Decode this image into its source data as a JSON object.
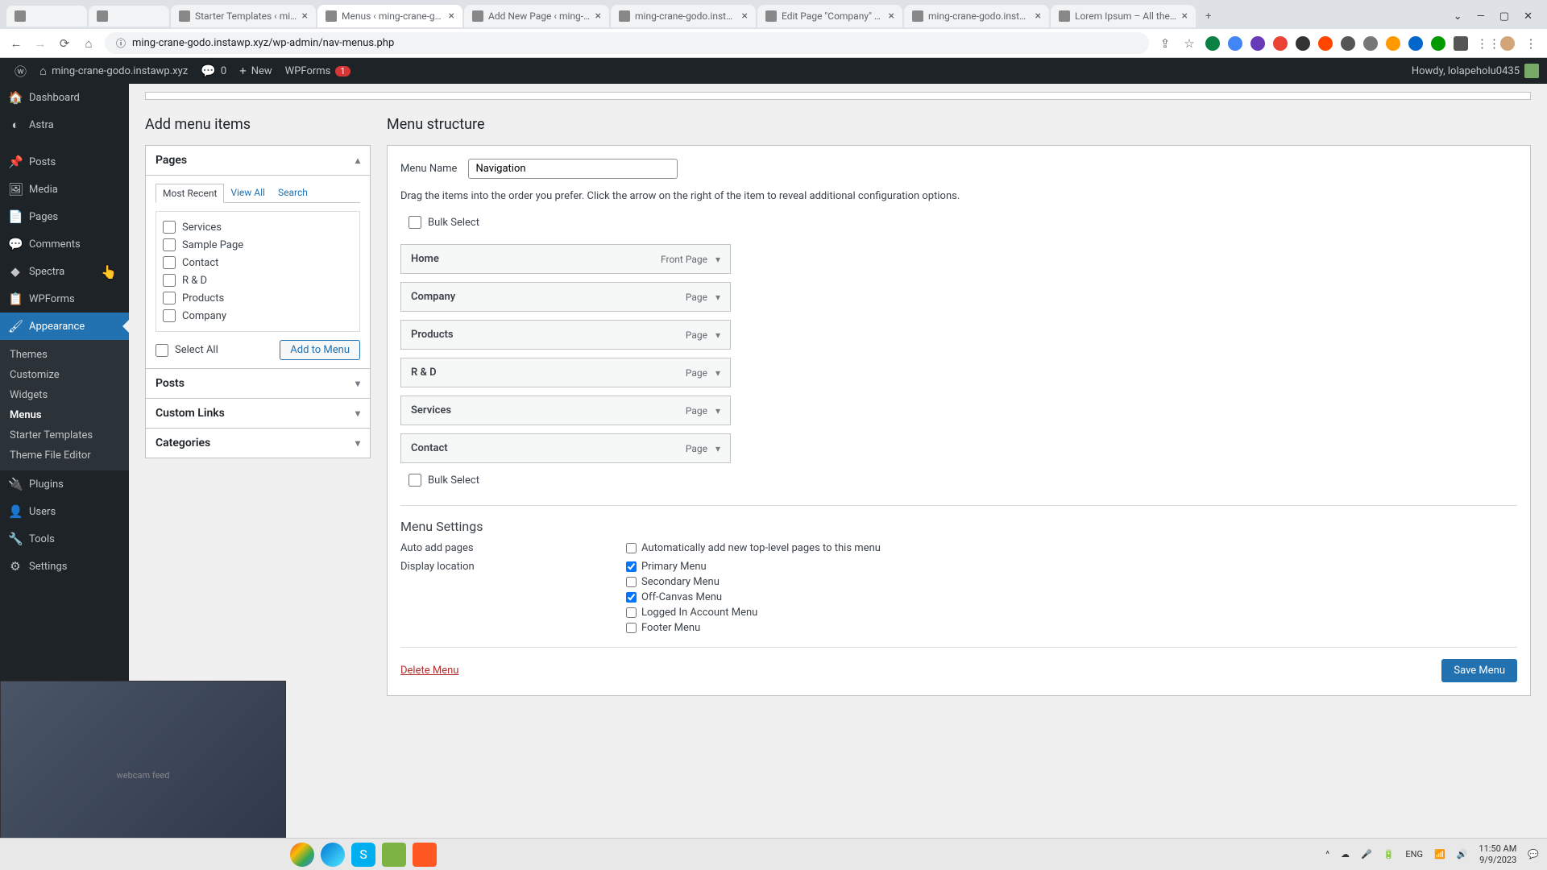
{
  "browser": {
    "tabs": [
      {
        "title": "Starter Templates ‹ ming-cran"
      },
      {
        "title": "Menus ‹ ming-crane-godo.",
        "active": true
      },
      {
        "title": "Add New Page ‹ ming-cran"
      },
      {
        "title": "ming-crane-godo.instawp.xyz"
      },
      {
        "title": "Edit Page \"Company\" ‹ ming"
      },
      {
        "title": "ming-crane-godo.instawp.xyz"
      },
      {
        "title": "Lorem Ipsum – All the facts - "
      }
    ],
    "url": "ming-crane-godo.instawp.xyz/wp-admin/nav-menus.php"
  },
  "adminbar": {
    "site": "ming-crane-godo.instawp.xyz",
    "comments": "0",
    "new": "New",
    "wpforms": "WPForms",
    "wpforms_count": "1",
    "howdy": "Howdy, lolapeholu0435"
  },
  "sidebar": {
    "items": [
      {
        "label": "Dashboard",
        "icon": "🏠"
      },
      {
        "label": "Astra",
        "icon": "◐"
      },
      {
        "label": "Posts",
        "icon": "📌"
      },
      {
        "label": "Media",
        "icon": "🖼"
      },
      {
        "label": "Pages",
        "icon": "📄"
      },
      {
        "label": "Comments",
        "icon": "💬"
      },
      {
        "label": "Spectra",
        "icon": "◆"
      },
      {
        "label": "WPForms",
        "icon": "📋"
      },
      {
        "label": "Appearance",
        "icon": "🖌",
        "current": true
      },
      {
        "label": "Plugins",
        "icon": "🔌"
      },
      {
        "label": "Users",
        "icon": "👤"
      },
      {
        "label": "Tools",
        "icon": "🔧"
      },
      {
        "label": "Settings",
        "icon": "⚙"
      }
    ],
    "submenu": [
      {
        "label": "Themes"
      },
      {
        "label": "Customize"
      },
      {
        "label": "Widgets"
      },
      {
        "label": "Menus",
        "current": true
      },
      {
        "label": "Starter Templates"
      },
      {
        "label": "Theme File Editor"
      }
    ]
  },
  "addmenu": {
    "heading": "Add menu items",
    "pages_label": "Pages",
    "tabs": {
      "recent": "Most Recent",
      "all": "View All",
      "search": "Search"
    },
    "pages": [
      {
        "label": "Services"
      },
      {
        "label": "Sample Page"
      },
      {
        "label": "Contact"
      },
      {
        "label": "R & D"
      },
      {
        "label": "Products"
      },
      {
        "label": "Company"
      }
    ],
    "select_all": "Select All",
    "add_btn": "Add to Menu",
    "posts_label": "Posts",
    "custom_label": "Custom Links",
    "categories_label": "Categories"
  },
  "structure": {
    "heading": "Menu structure",
    "name_label": "Menu Name",
    "name_value": "Navigation",
    "instructions": "Drag the items into the order you prefer. Click the arrow on the right of the item to reveal additional configuration options.",
    "bulk_select": "Bulk Select",
    "items": [
      {
        "title": "Home",
        "type": "Front Page"
      },
      {
        "title": "Company",
        "type": "Page"
      },
      {
        "title": "Products",
        "type": "Page"
      },
      {
        "title": "R & D",
        "type": "Page"
      },
      {
        "title": "Services",
        "type": "Page"
      },
      {
        "title": "Contact",
        "type": "Page"
      }
    ],
    "settings_heading": "Menu Settings",
    "auto_label": "Auto add pages",
    "auto_option": "Automatically add new top-level pages to this menu",
    "display_label": "Display location",
    "locations": [
      {
        "label": "Primary Menu",
        "checked": true
      },
      {
        "label": "Secondary Menu",
        "checked": false
      },
      {
        "label": "Off-Canvas Menu",
        "checked": true
      },
      {
        "label": "Logged In Account Menu",
        "checked": false
      },
      {
        "label": "Footer Menu",
        "checked": false
      }
    ],
    "delete": "Delete Menu",
    "save": "Save Menu"
  },
  "taskbar": {
    "lang": "ENG",
    "time": "11:50 AM",
    "date": "9/9/2023"
  }
}
